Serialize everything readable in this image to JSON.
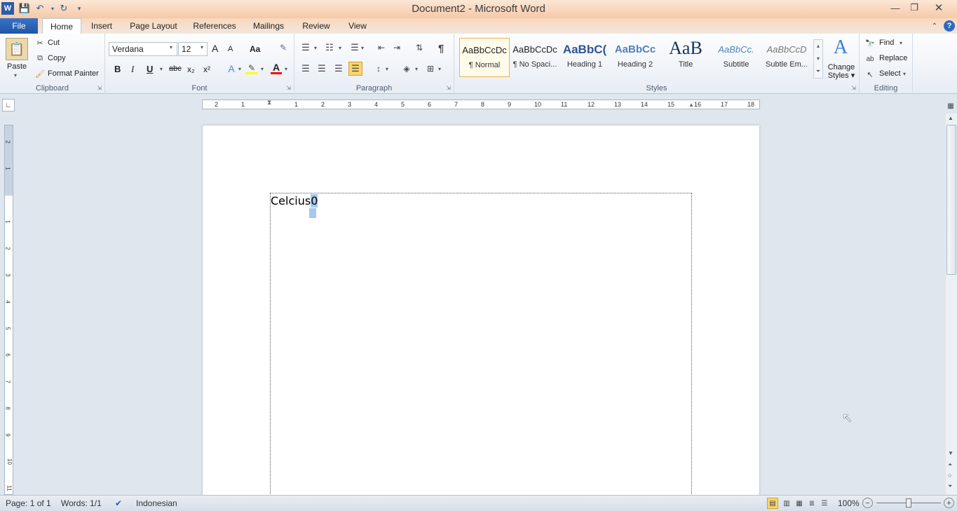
{
  "window": {
    "title": "Document2 - Microsoft Word"
  },
  "tabs": [
    {
      "label": "File"
    },
    {
      "label": "Home"
    },
    {
      "label": "Insert"
    },
    {
      "label": "Page Layout"
    },
    {
      "label": "References"
    },
    {
      "label": "Mailings"
    },
    {
      "label": "Review"
    },
    {
      "label": "View"
    }
  ],
  "clipboard": {
    "label": "Clipboard",
    "paste": "Paste",
    "cut": "Cut",
    "copy": "Copy",
    "format_painter": "Format Painter"
  },
  "font": {
    "label": "Font",
    "family": "Verdana",
    "size": "12",
    "bold": "B",
    "italic": "I",
    "underline": "U",
    "strike": "abc",
    "subscript": "x₂",
    "superscript": "x²",
    "grow": "A",
    "shrink": "A",
    "case": "Aa"
  },
  "paragraph": {
    "label": "Paragraph",
    "pilcrow": "¶"
  },
  "styles": {
    "label": "Styles",
    "items": [
      {
        "preview": "AaBbCcDc",
        "name": "¶ Normal"
      },
      {
        "preview": "AaBbCcDc",
        "name": "¶ No Spaci..."
      },
      {
        "preview": "AaBbC(",
        "name": "Heading 1"
      },
      {
        "preview": "AaBbCc",
        "name": "Heading 2"
      },
      {
        "preview": "AaB",
        "name": "Title"
      },
      {
        "preview": "AaBbCc.",
        "name": "Subtitle"
      },
      {
        "preview": "AaBbCcD",
        "name": "Subtle Em..."
      }
    ],
    "change_styles": "Change Styles",
    "change_styles_l1": "Change",
    "change_styles_l2": "Styles"
  },
  "editing": {
    "label": "Editing",
    "find": "Find",
    "replace": "Replace",
    "select": "Select"
  },
  "document": {
    "text": "Celcius",
    "selected": "0"
  },
  "ruler": {
    "top_ticks": [
      "2",
      "1",
      "1",
      "2",
      "3",
      "4",
      "5",
      "6",
      "7",
      "8",
      "9",
      "10",
      "11",
      "12",
      "13",
      "14",
      "15",
      "16",
      "17",
      "18"
    ],
    "left_ticks": [
      "2",
      "1",
      "1",
      "2",
      "3",
      "4",
      "5",
      "6",
      "7",
      "8",
      "9",
      "10",
      "11"
    ]
  },
  "status": {
    "page": "Page: 1 of 1",
    "words": "Words: 1/1",
    "language": "Indonesian",
    "zoom": "100%"
  },
  "colors": {
    "file_tab": "#2b579a",
    "highlight": "#ffff00",
    "font_color": "#ff0000",
    "selection": "#a6c7ee"
  }
}
